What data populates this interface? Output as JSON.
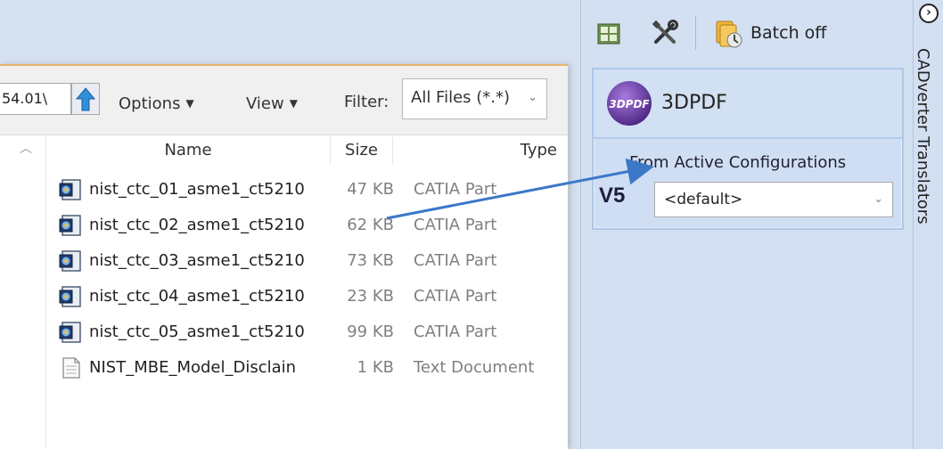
{
  "file_dialog": {
    "path_value": "54.01\\",
    "options_label": "Options",
    "view_label": "View",
    "filter_label": "Filter:",
    "filter_value": "All Files (*.*)",
    "columns": {
      "name": "Name",
      "size": "Size",
      "type": "Type"
    },
    "files": [
      {
        "name": "nist_ctc_01_asme1_ct5210",
        "size": "47 KB",
        "type": "CATIA Part",
        "icon": "catia-part-icon"
      },
      {
        "name": "nist_ctc_02_asme1_ct5210",
        "size": "62 KB",
        "type": "CATIA Part",
        "icon": "catia-part-icon"
      },
      {
        "name": "nist_ctc_03_asme1_ct5210",
        "size": "73 KB",
        "type": "CATIA Part",
        "icon": "catia-part-icon"
      },
      {
        "name": "nist_ctc_04_asme1_ct5210",
        "size": "23 KB",
        "type": "CATIA Part",
        "icon": "catia-part-icon"
      },
      {
        "name": "nist_ctc_05_asme1_ct5210",
        "size": "99 KB",
        "type": "CATIA Part",
        "icon": "catia-part-icon"
      },
      {
        "name": "NIST_MBE_Model_Disclain",
        "size": "1 KB",
        "type": "Text Document",
        "icon": "text-document-icon"
      }
    ]
  },
  "right_panel": {
    "batch_label": "Batch off",
    "card_title": "3DPDF",
    "logo_text": "3DPDF",
    "config_label": "From Active Configurations",
    "version_label": "V5",
    "config_value": "<default>"
  },
  "side_strip": {
    "title": "CADverter Translators"
  },
  "colors": {
    "accent_blue": "#3b78c8",
    "panel_bg": "#d3e0f2",
    "logo_purple": "#6a3fa0"
  }
}
